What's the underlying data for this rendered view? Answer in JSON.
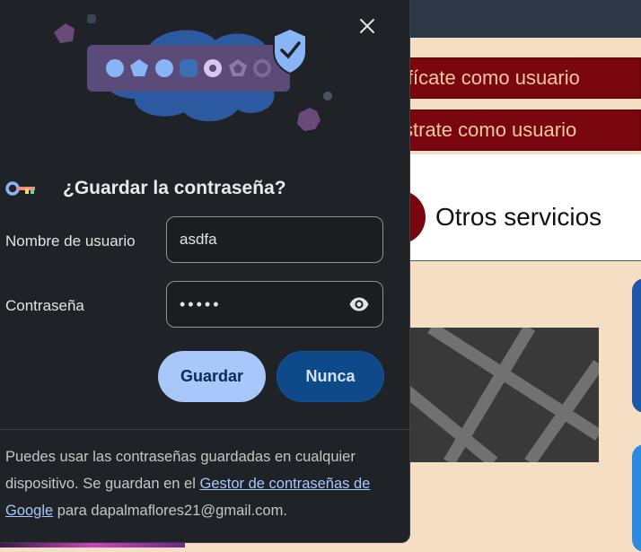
{
  "background": {
    "button_auth": "ifícate como usuario",
    "button_register": "strate como usuario",
    "services_label": "Otros servicios",
    "colors": {
      "accent_red": "#7a0710",
      "page_bg": "#f4dfc5",
      "topbar": "#2d3746"
    }
  },
  "dialog": {
    "title": "¿Guardar la contraseña?",
    "close_icon": "close-icon",
    "key_icon": "password-key-icon",
    "username_label": "Nombre de usuario",
    "username_value": "asdfa",
    "password_label": "Contraseña",
    "password_value": "•••••",
    "eye_icon": "show-password-icon",
    "save_label": "Guardar",
    "never_label": "Nunca",
    "footer_text_1": "Puedes usar las contraseñas guardadas en cualquier dispositivo. Se guardan en el ",
    "footer_link": "Gestor de contraseñas de Google",
    "footer_text_2": " para dapalmaflores21@gmail.com.",
    "colors": {
      "bg": "#1f2226",
      "primary_button": "#a8c7fa",
      "secondary_button": "#0e4a8a",
      "link": "#a8c7fa"
    }
  }
}
